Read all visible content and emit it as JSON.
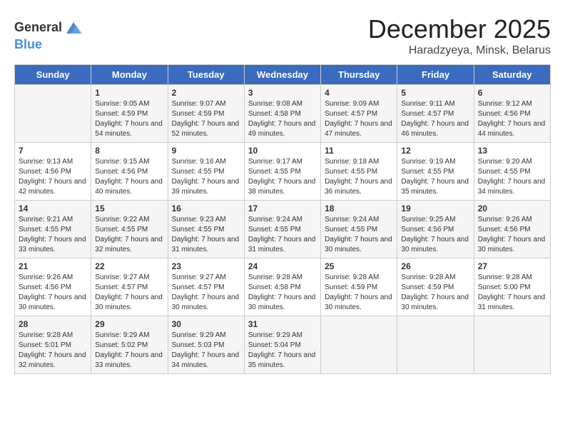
{
  "logo": {
    "text_general": "General",
    "text_blue": "Blue"
  },
  "header": {
    "month": "December 2025",
    "location": "Haradzyeya, Minsk, Belarus"
  },
  "days_of_week": [
    "Sunday",
    "Monday",
    "Tuesday",
    "Wednesday",
    "Thursday",
    "Friday",
    "Saturday"
  ],
  "weeks": [
    [
      {
        "day": "",
        "sunrise": "",
        "sunset": "",
        "daylight": ""
      },
      {
        "day": "1",
        "sunrise": "Sunrise: 9:05 AM",
        "sunset": "Sunset: 4:59 PM",
        "daylight": "Daylight: 7 hours and 54 minutes."
      },
      {
        "day": "2",
        "sunrise": "Sunrise: 9:07 AM",
        "sunset": "Sunset: 4:59 PM",
        "daylight": "Daylight: 7 hours and 52 minutes."
      },
      {
        "day": "3",
        "sunrise": "Sunrise: 9:08 AM",
        "sunset": "Sunset: 4:58 PM",
        "daylight": "Daylight: 7 hours and 49 minutes."
      },
      {
        "day": "4",
        "sunrise": "Sunrise: 9:09 AM",
        "sunset": "Sunset: 4:57 PM",
        "daylight": "Daylight: 7 hours and 47 minutes."
      },
      {
        "day": "5",
        "sunrise": "Sunrise: 9:11 AM",
        "sunset": "Sunset: 4:57 PM",
        "daylight": "Daylight: 7 hours and 46 minutes."
      },
      {
        "day": "6",
        "sunrise": "Sunrise: 9:12 AM",
        "sunset": "Sunset: 4:56 PM",
        "daylight": "Daylight: 7 hours and 44 minutes."
      }
    ],
    [
      {
        "day": "7",
        "sunrise": "Sunrise: 9:13 AM",
        "sunset": "Sunset: 4:56 PM",
        "daylight": "Daylight: 7 hours and 42 minutes."
      },
      {
        "day": "8",
        "sunrise": "Sunrise: 9:15 AM",
        "sunset": "Sunset: 4:56 PM",
        "daylight": "Daylight: 7 hours and 40 minutes."
      },
      {
        "day": "9",
        "sunrise": "Sunrise: 9:16 AM",
        "sunset": "Sunset: 4:55 PM",
        "daylight": "Daylight: 7 hours and 39 minutes."
      },
      {
        "day": "10",
        "sunrise": "Sunrise: 9:17 AM",
        "sunset": "Sunset: 4:55 PM",
        "daylight": "Daylight: 7 hours and 38 minutes."
      },
      {
        "day": "11",
        "sunrise": "Sunrise: 9:18 AM",
        "sunset": "Sunset: 4:55 PM",
        "daylight": "Daylight: 7 hours and 36 minutes."
      },
      {
        "day": "12",
        "sunrise": "Sunrise: 9:19 AM",
        "sunset": "Sunset: 4:55 PM",
        "daylight": "Daylight: 7 hours and 35 minutes."
      },
      {
        "day": "13",
        "sunrise": "Sunrise: 9:20 AM",
        "sunset": "Sunset: 4:55 PM",
        "daylight": "Daylight: 7 hours and 34 minutes."
      }
    ],
    [
      {
        "day": "14",
        "sunrise": "Sunrise: 9:21 AM",
        "sunset": "Sunset: 4:55 PM",
        "daylight": "Daylight: 7 hours and 33 minutes."
      },
      {
        "day": "15",
        "sunrise": "Sunrise: 9:22 AM",
        "sunset": "Sunset: 4:55 PM",
        "daylight": "Daylight: 7 hours and 32 minutes."
      },
      {
        "day": "16",
        "sunrise": "Sunrise: 9:23 AM",
        "sunset": "Sunset: 4:55 PM",
        "daylight": "Daylight: 7 hours and 31 minutes."
      },
      {
        "day": "17",
        "sunrise": "Sunrise: 9:24 AM",
        "sunset": "Sunset: 4:55 PM",
        "daylight": "Daylight: 7 hours and 31 minutes."
      },
      {
        "day": "18",
        "sunrise": "Sunrise: 9:24 AM",
        "sunset": "Sunset: 4:55 PM",
        "daylight": "Daylight: 7 hours and 30 minutes."
      },
      {
        "day": "19",
        "sunrise": "Sunrise: 9:25 AM",
        "sunset": "Sunset: 4:56 PM",
        "daylight": "Daylight: 7 hours and 30 minutes."
      },
      {
        "day": "20",
        "sunrise": "Sunrise: 9:26 AM",
        "sunset": "Sunset: 4:56 PM",
        "daylight": "Daylight: 7 hours and 30 minutes."
      }
    ],
    [
      {
        "day": "21",
        "sunrise": "Sunrise: 9:26 AM",
        "sunset": "Sunset: 4:56 PM",
        "daylight": "Daylight: 7 hours and 30 minutes."
      },
      {
        "day": "22",
        "sunrise": "Sunrise: 9:27 AM",
        "sunset": "Sunset: 4:57 PM",
        "daylight": "Daylight: 7 hours and 30 minutes."
      },
      {
        "day": "23",
        "sunrise": "Sunrise: 9:27 AM",
        "sunset": "Sunset: 4:57 PM",
        "daylight": "Daylight: 7 hours and 30 minutes."
      },
      {
        "day": "24",
        "sunrise": "Sunrise: 9:28 AM",
        "sunset": "Sunset: 4:58 PM",
        "daylight": "Daylight: 7 hours and 30 minutes."
      },
      {
        "day": "25",
        "sunrise": "Sunrise: 9:28 AM",
        "sunset": "Sunset: 4:59 PM",
        "daylight": "Daylight: 7 hours and 30 minutes."
      },
      {
        "day": "26",
        "sunrise": "Sunrise: 9:28 AM",
        "sunset": "Sunset: 4:59 PM",
        "daylight": "Daylight: 7 hours and 30 minutes."
      },
      {
        "day": "27",
        "sunrise": "Sunrise: 9:28 AM",
        "sunset": "Sunset: 5:00 PM",
        "daylight": "Daylight: 7 hours and 31 minutes."
      }
    ],
    [
      {
        "day": "28",
        "sunrise": "Sunrise: 9:28 AM",
        "sunset": "Sunset: 5:01 PM",
        "daylight": "Daylight: 7 hours and 32 minutes."
      },
      {
        "day": "29",
        "sunrise": "Sunrise: 9:29 AM",
        "sunset": "Sunset: 5:02 PM",
        "daylight": "Daylight: 7 hours and 33 minutes."
      },
      {
        "day": "30",
        "sunrise": "Sunrise: 9:29 AM",
        "sunset": "Sunset: 5:03 PM",
        "daylight": "Daylight: 7 hours and 34 minutes."
      },
      {
        "day": "31",
        "sunrise": "Sunrise: 9:29 AM",
        "sunset": "Sunset: 5:04 PM",
        "daylight": "Daylight: 7 hours and 35 minutes."
      },
      {
        "day": "",
        "sunrise": "",
        "sunset": "",
        "daylight": ""
      },
      {
        "day": "",
        "sunrise": "",
        "sunset": "",
        "daylight": ""
      },
      {
        "day": "",
        "sunrise": "",
        "sunset": "",
        "daylight": ""
      }
    ]
  ]
}
